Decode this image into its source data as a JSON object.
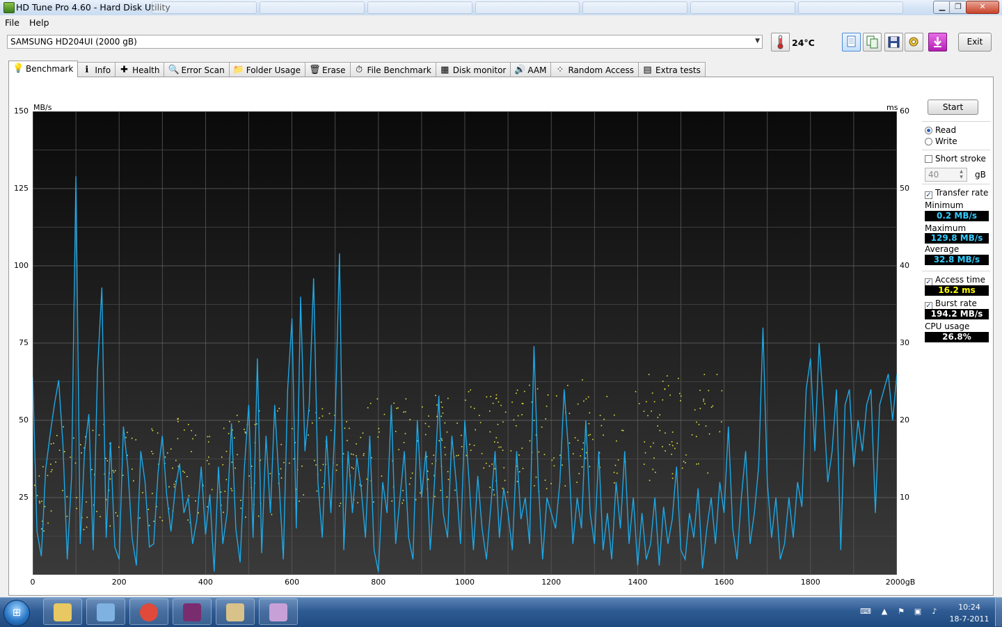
{
  "window": {
    "title": "HD Tune Pro 4.60 - Hard Disk Utility",
    "minimize_glyph": "▁",
    "maximize_glyph": "❐",
    "close_glyph": "✕"
  },
  "menu": {
    "file": "File",
    "help": "Help"
  },
  "toolbar": {
    "drive": "SAMSUNG HD204UI (2000 gB)",
    "temperature": "24°C",
    "exit_label": "Exit"
  },
  "tabs": [
    {
      "label": "Benchmark",
      "icon": "benchmark-icon",
      "glyph": "💡",
      "active": true
    },
    {
      "label": "Info",
      "icon": "info-icon",
      "glyph": "ℹ",
      "active": false
    },
    {
      "label": "Health",
      "icon": "health-icon",
      "glyph": "✚",
      "active": false
    },
    {
      "label": "Error Scan",
      "icon": "error-scan-icon",
      "glyph": "🔍",
      "active": false
    },
    {
      "label": "Folder Usage",
      "icon": "folder-icon",
      "glyph": "📁",
      "active": false
    },
    {
      "label": "Erase",
      "icon": "erase-icon",
      "glyph": "🗑",
      "active": false
    },
    {
      "label": "File Benchmark",
      "icon": "file-benchmark-icon",
      "glyph": "⏱",
      "active": false
    },
    {
      "label": "Disk monitor",
      "icon": "disk-monitor-icon",
      "glyph": "▦",
      "active": false
    },
    {
      "label": "AAM",
      "icon": "aam-icon",
      "glyph": "🔊",
      "active": false
    },
    {
      "label": "Random Access",
      "icon": "random-access-icon",
      "glyph": "⁘",
      "active": false
    },
    {
      "label": "Extra tests",
      "icon": "extra-tests-icon",
      "glyph": "▤",
      "active": false
    }
  ],
  "controls": {
    "start_label": "Start",
    "read_label": "Read",
    "write_label": "Write",
    "short_stroke_label": "Short stroke",
    "short_stroke_value": "40",
    "short_stroke_unit": "gB",
    "transfer_rate_label": "Transfer rate",
    "access_time_label": "Access time",
    "burst_rate_label": "Burst rate",
    "cpu_usage_label": "CPU usage",
    "mode": "read"
  },
  "stats": {
    "minimum_label": "Minimum",
    "minimum": "0.2 MB/s",
    "maximum_label": "Maximum",
    "maximum": "129.8 MB/s",
    "average_label": "Average",
    "average": "32.8 MB/s",
    "access_time": "16.2 ms",
    "burst_rate": "194.2 MB/s",
    "cpu_usage": "26.8%",
    "colors": {
      "transfer": "#33ccff",
      "access": "#ffff00",
      "burst": "#ffffff",
      "cpu": "#ffffff"
    }
  },
  "taskbar": {
    "clock_time": "10:24",
    "clock_date": "18-7-2011",
    "buttons": [
      "explorer-icon",
      "control-panel-icon",
      "chrome-icon",
      "winrar-icon",
      "hdtune-icon",
      "paint-icon"
    ]
  },
  "chart_data": {
    "type": "line",
    "ylabel_left": "MB/s",
    "ylabel_right": "ms",
    "xunit": "gB",
    "xlim": [
      0,
      2000
    ],
    "ylim_left": [
      0,
      150
    ],
    "ylim_right": [
      0,
      60
    ],
    "x_ticks": [
      0,
      200,
      400,
      600,
      800,
      1000,
      1200,
      1400,
      1600,
      1800,
      2000
    ],
    "x_tick_labels": [
      "0",
      "200",
      "400",
      "600",
      "800",
      "1000",
      "1200",
      "1400",
      "1600",
      "1800",
      "2000gB"
    ],
    "y_ticks_left": [
      25,
      50,
      75,
      100,
      125,
      150
    ],
    "y_ticks_right": [
      10,
      20,
      30,
      40,
      50,
      60
    ],
    "grid": true,
    "colors": {
      "transfer": "#1ea8e6",
      "access": "#e6e63c"
    },
    "series": [
      {
        "kind": "transfer_rate",
        "x": [
          0,
          10,
          20,
          30,
          40,
          50,
          60,
          70,
          80,
          90,
          100,
          110,
          120,
          130,
          140,
          150,
          160,
          170,
          180,
          190,
          200,
          210,
          220,
          230,
          240,
          250,
          260,
          270,
          280,
          290,
          300,
          310,
          320,
          330,
          340,
          350,
          360,
          370,
          380,
          390,
          400,
          410,
          420,
          430,
          440,
          450,
          460,
          470,
          480,
          490,
          500,
          510,
          520,
          530,
          540,
          550,
          560,
          570,
          580,
          590,
          600,
          610,
          620,
          630,
          640,
          650,
          660,
          670,
          680,
          690,
          700,
          710,
          720,
          730,
          740,
          750,
          760,
          770,
          780,
          790,
          800,
          810,
          820,
          830,
          840,
          850,
          860,
          870,
          880,
          890,
          900,
          910,
          920,
          930,
          940,
          950,
          960,
          970,
          980,
          990,
          1000,
          1010,
          1020,
          1030,
          1040,
          1050,
          1060,
          1070,
          1080,
          1090,
          1100,
          1110,
          1120,
          1130,
          1140,
          1150,
          1160,
          1170,
          1180,
          1190,
          1200,
          1210,
          1220,
          1230,
          1240,
          1250,
          1260,
          1270,
          1280,
          1290,
          1300,
          1310,
          1320,
          1330,
          1340,
          1350,
          1360,
          1370,
          1380,
          1390,
          1400,
          1410,
          1420,
          1430,
          1440,
          1450,
          1460,
          1470,
          1480,
          1490,
          1500,
          1510,
          1520,
          1530,
          1540,
          1550,
          1560,
          1570,
          1580,
          1590,
          1600,
          1610,
          1620,
          1630,
          1640,
          1650,
          1660,
          1670,
          1680,
          1690,
          1700,
          1710,
          1720,
          1730,
          1740,
          1750,
          1760,
          1770,
          1780,
          1790,
          1800,
          1810,
          1820,
          1830,
          1840,
          1850,
          1860,
          1870,
          1880,
          1890,
          1900,
          1910,
          1920,
          1930,
          1940,
          1950,
          1960,
          1970,
          1980,
          1990,
          2000
        ],
        "y": [
          64,
          14,
          6,
          34,
          45,
          55,
          63,
          42,
          5,
          32,
          129,
          10,
          40,
          52,
          8,
          66,
          93,
          12,
          43,
          9,
          5,
          48,
          35,
          12,
          3,
          40,
          30,
          9,
          10,
          33,
          45,
          26,
          14,
          28,
          36,
          20,
          25,
          10,
          18,
          35,
          13,
          26,
          1,
          35,
          10,
          20,
          49,
          15,
          4,
          35,
          55,
          12,
          70,
          7,
          45,
          20,
          55,
          30,
          5,
          60,
          83,
          15,
          90,
          40,
          55,
          96,
          30,
          12,
          45,
          20,
          50,
          104,
          8,
          40,
          20,
          38,
          28,
          12,
          45,
          8,
          1,
          30,
          20,
          55,
          10,
          25,
          40,
          12,
          5,
          50,
          25,
          40,
          8,
          30,
          58,
          20,
          12,
          45,
          30,
          10,
          50,
          30,
          8,
          32,
          15,
          5,
          22,
          40,
          12,
          28,
          20,
          8,
          40,
          18,
          25,
          10,
          74,
          30,
          5,
          25,
          20,
          15,
          30,
          60,
          40,
          10,
          25,
          15,
          50,
          20,
          10,
          40,
          8,
          20,
          5,
          30,
          15,
          40,
          10,
          25,
          3,
          20,
          5,
          10,
          25,
          3,
          22,
          10,
          18,
          35,
          8,
          5,
          20,
          12,
          28,
          2,
          15,
          25,
          10,
          30,
          20,
          48,
          15,
          5,
          25,
          40,
          10,
          20,
          35,
          80,
          30,
          12,
          25,
          5,
          10,
          25,
          12,
          30,
          22,
          60,
          70,
          40,
          75,
          55,
          30,
          40,
          60,
          8,
          55,
          60,
          35,
          50,
          40,
          55,
          60,
          20,
          55,
          60,
          65,
          50,
          65
        ]
      }
    ],
    "access_time_scatter": {
      "x_range_gB": [
        0,
        1600
      ],
      "y_range_ms": [
        5,
        26
      ],
      "note": "scattered access-time samples"
    }
  }
}
